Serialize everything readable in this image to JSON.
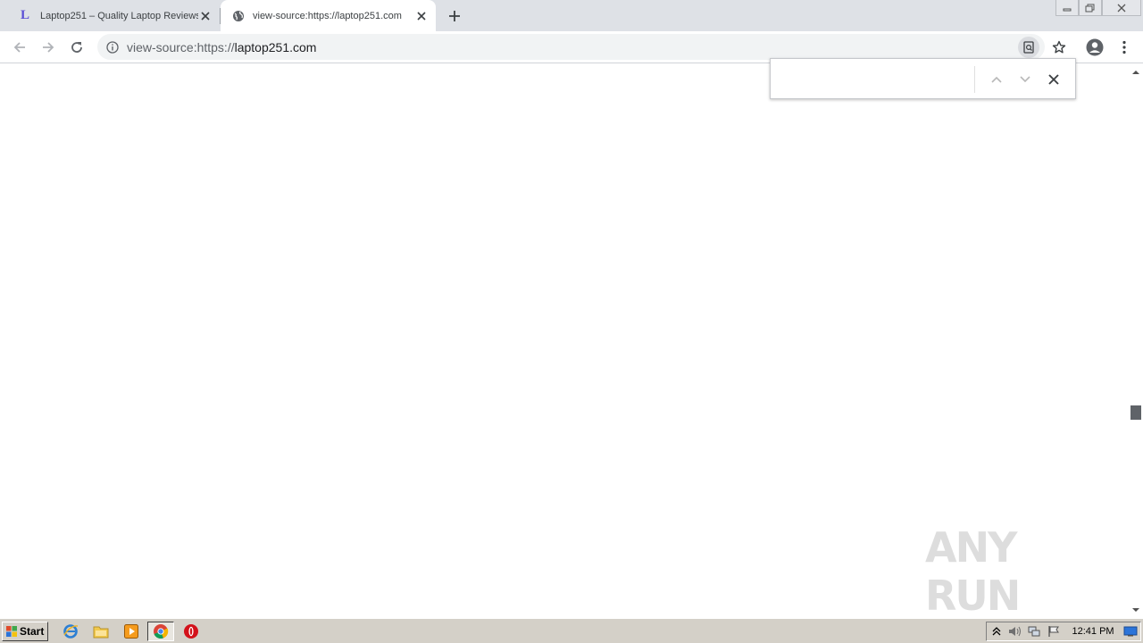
{
  "browser": {
    "tabs": [
      {
        "title": "Laptop251 – Quality Laptop Reviews",
        "favicon_letter": "L",
        "active": false
      },
      {
        "title": "view-source:https://laptop251.com",
        "active": true
      }
    ],
    "address_bar": {
      "url_prefix": "view-source:https://",
      "url_host": "laptop251.com"
    },
    "find_bar": {
      "query": "",
      "placeholder": ""
    }
  },
  "watermark": {
    "text": "ANY RUN"
  },
  "taskbar": {
    "start_label": "Start",
    "clock": "12:41 PM"
  },
  "colors": {
    "tabstrip_bg": "#dee1e6",
    "omnibox_bg": "#f1f3f4",
    "taskbar_bg": "#d4d0c8",
    "favicon_L": "#5b4fd6"
  }
}
